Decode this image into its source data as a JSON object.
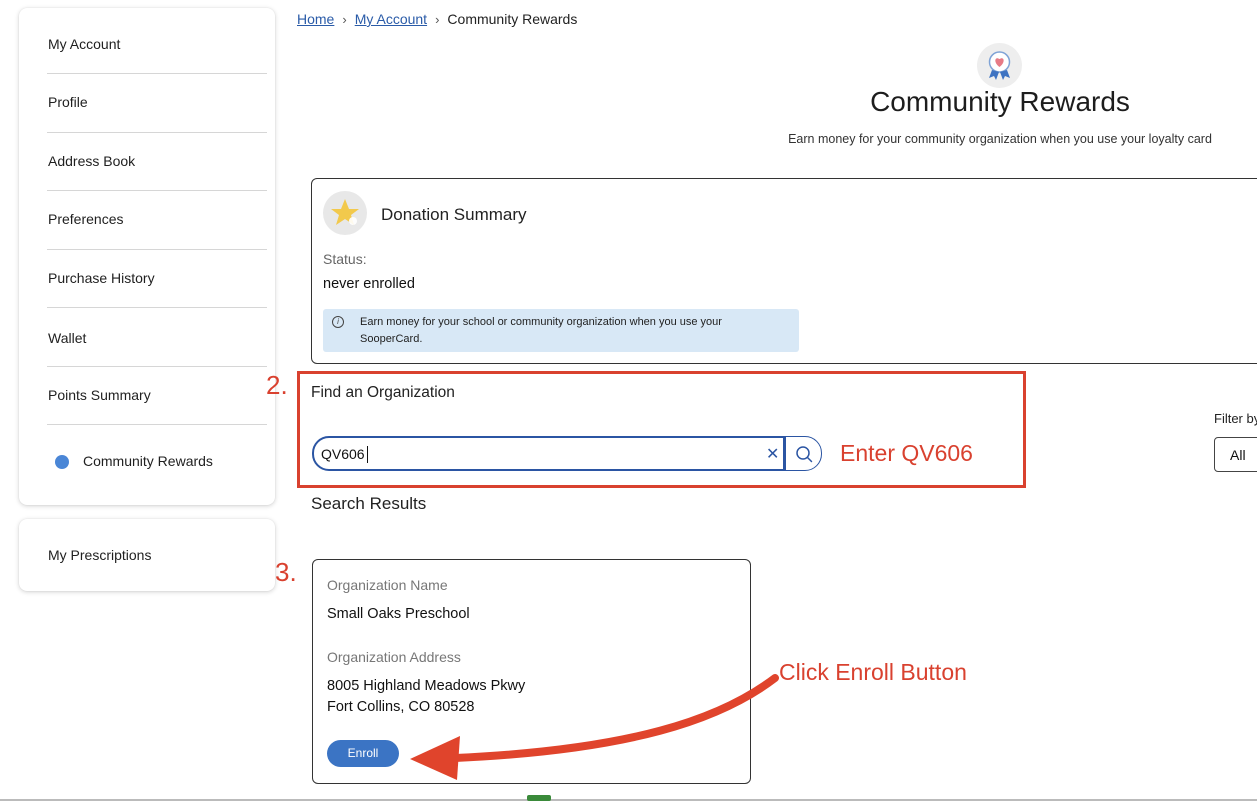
{
  "sidebar": {
    "items": [
      {
        "label": "My Account"
      },
      {
        "label": "Profile"
      },
      {
        "label": "Address Book"
      },
      {
        "label": "Preferences"
      },
      {
        "label": "Purchase History"
      },
      {
        "label": "Wallet"
      },
      {
        "label": "Points Summary"
      },
      {
        "label": "Community Rewards",
        "active": true
      }
    ],
    "secondary": {
      "label": "My Prescriptions"
    }
  },
  "breadcrumb": {
    "home": "Home",
    "account": "My Account",
    "current": "Community Rewards"
  },
  "header": {
    "title": "Community Rewards",
    "subtitle": "Earn money for your community organization when you use your loyalty card"
  },
  "donation": {
    "title": "Donation Summary",
    "status_label": "Status:",
    "status_value": "never enrolled",
    "info_text": "Earn money for your school or community organization when you use your SooperCard."
  },
  "search": {
    "label": "Find an Organization",
    "value": "QV606",
    "filter_label": "Filter by",
    "filter_value": "All"
  },
  "results": {
    "label": "Search Results",
    "items": [
      {
        "name_label": "Organization Name",
        "name": "Small Oaks Preschool",
        "address_label": "Organization Address",
        "address_line1": "8005 Highland Meadows Pkwy",
        "address_line2": "Fort Collins, CO 80528",
        "button": "Enroll"
      }
    ]
  },
  "annotations": {
    "step2": "2.",
    "step3": "3.",
    "enter_hint": "Enter QV606",
    "click_hint": "Click Enroll Button"
  },
  "colors": {
    "annotation_red": "#d9412f",
    "brand_blue": "#2b55a3",
    "button_blue": "#3b74c4",
    "info_bg": "#d8e8f6"
  }
}
